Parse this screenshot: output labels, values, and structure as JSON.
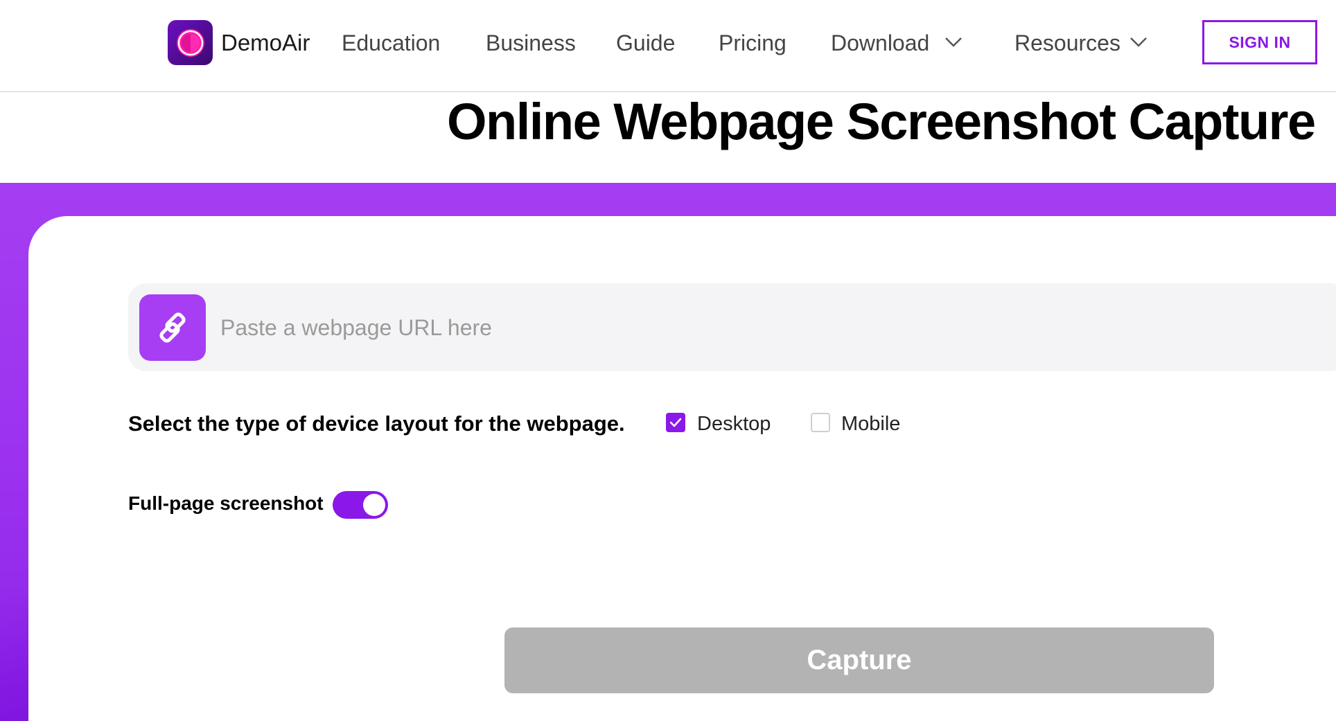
{
  "header": {
    "brand": "DemoAir",
    "nav": [
      {
        "label": "Education"
      },
      {
        "label": "Business"
      },
      {
        "label": "Guide"
      },
      {
        "label": "Pricing"
      },
      {
        "label": "Download",
        "dropdown": true
      },
      {
        "label": "Resources",
        "dropdown": true
      }
    ],
    "signin_label": "SIGN IN"
  },
  "page_title": "Online Webpage Screenshot Capture",
  "url_input": {
    "value": "",
    "placeholder": "Paste a webpage URL here"
  },
  "layout_select": {
    "label": "Select the type of device layout for the webpage.",
    "options": [
      {
        "label": "Desktop",
        "checked": true
      },
      {
        "label": "Mobile",
        "checked": false
      }
    ]
  },
  "full_page": {
    "label": "Full-page screenshot",
    "enabled": true
  },
  "capture_label": "Capture",
  "colors": {
    "accent": "#8a18e8",
    "band": "#a53ef2",
    "button_disabled": "#b3b3b3"
  },
  "icons": {
    "logo": "demoair-logo-icon",
    "link": "link-icon",
    "chevron": "chevron-down-icon",
    "check": "check-icon"
  }
}
